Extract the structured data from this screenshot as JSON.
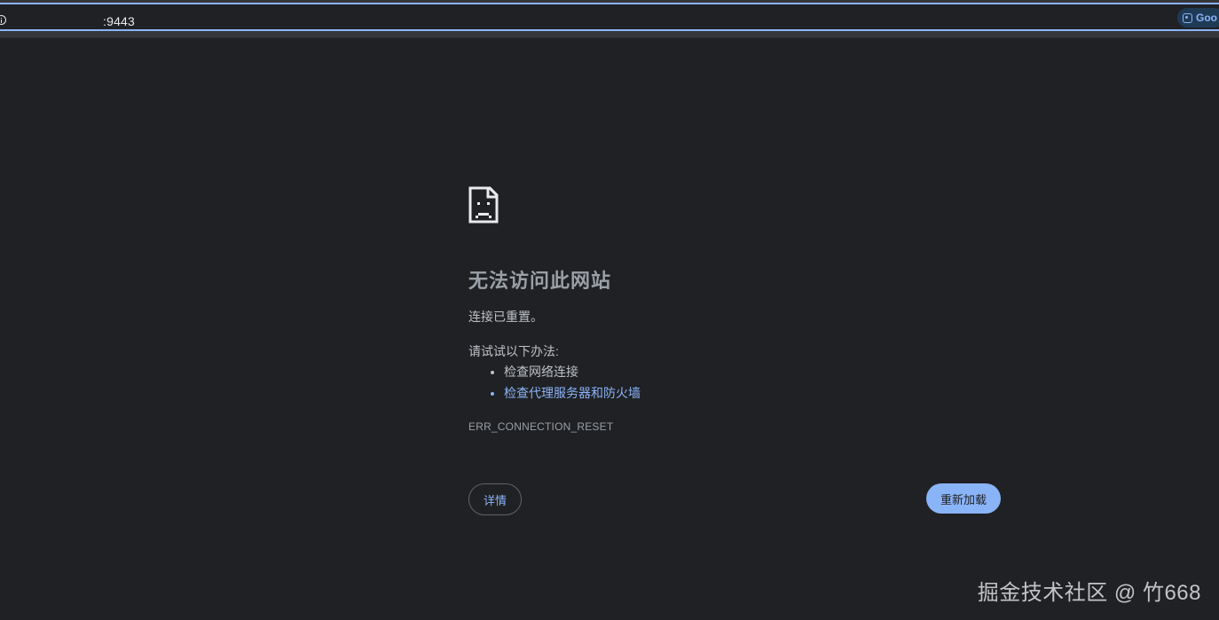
{
  "address_bar": {
    "url_visible": ":9443",
    "lens_chip_label": "Goo"
  },
  "error": {
    "headline": "无法访问此网站",
    "summary": "连接已重置。",
    "suggestions_heading": "请试试以下办法:",
    "suggestions": [
      "检查网络连接",
      "检查代理服务器和防火墙"
    ],
    "error_code": "ERR_CONNECTION_RESET"
  },
  "buttons": {
    "details_label": "详情",
    "reload_label": "重新加载"
  },
  "watermark": "掘金技术社区 @ 竹668",
  "colors": {
    "background": "#202124",
    "link": "#8ab4f8",
    "omnibox_focus": "#8ab4f8",
    "text": "#bdc1c6"
  }
}
